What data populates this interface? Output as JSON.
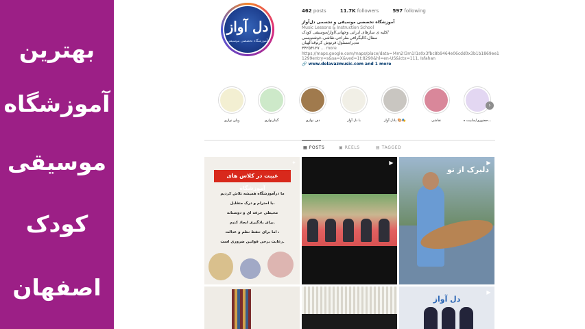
{
  "banner": {
    "lines": [
      "بهترین",
      "آموزشگاه",
      "موسیقی",
      "کودک",
      "اصفهان"
    ]
  },
  "profile": {
    "avatar_text": "دل آواز",
    "avatar_caption": "آموزشگاه تخصصی موسیقی",
    "stats": {
      "posts_value": "462",
      "posts_label": "posts",
      "followers_value": "11.7K",
      "followers_label": "followers",
      "following_value": "597",
      "following_label": "following"
    },
    "bio": {
      "name": "آموزشگاه تخصصی موسیقی و تجسمی دل‌آواز",
      "category": "Music Lessons & Instruction School",
      "line1": "کلیه ی سازهای ایرانی وجهانی/آواز/موسیقی کودک/",
      "line2": "سفال،کالیگرافی،طراحی،نقاشی،خوشنویسی",
      "line3": "مدیر/مسئول:فرنوش کرم‌قدالهیان",
      "line4": "۳۴۲۵۴۱۲۷",
      "more": "... more",
      "url": "https://maps.google.com/maps/place/data=!4m2!3m1!1s0x3fbc8b9464e06cdd0x3b1b1869ee11299entry=s&sa=X&ved=1t:8290&hl=en-US&ictx=111, Isfahan",
      "website": "www.delavazmusic.com and 1 more"
    }
  },
  "highlights": [
    {
      "label": "حضوری/سابیت ه...",
      "icon": "music-icon"
    },
    {
      "label": "نقاشی",
      "icon": "flower-icon"
    },
    {
      "label": "پادل آواز 🎨🎭",
      "icon": "chair-icon"
    },
    {
      "label": "با دل آواز",
      "icon": "music-logo-icon"
    },
    {
      "label": "دف نوازی",
      "icon": "daf-icon"
    },
    {
      "label": "گیتارنوازی",
      "icon": "guitar-icon"
    },
    {
      "label": "ویلن نوازی",
      "icon": "violin-icon"
    }
  ],
  "tabs": {
    "posts": "POSTS",
    "reels": "REELS",
    "tagged": "TAGGED"
  },
  "posts": {
    "p1_banner": "غیبت در کلاس های آموزشگاه",
    "p1_lines": [
      "ما درآموزشگاه همیشه تلاش کردیم",
      "با احترام و درک متقابل،",
      "محیطی حرفه ای و دوستانه",
      "برای یادگیری ایجاد کنیم.",
      "اما برای حفظ نظم و عدالت ،",
      "رعایت برخی قوانین ضروری است."
    ],
    "p3_title": "دلبرک از تو",
    "p6_title": "دل آواز"
  },
  "colors": {
    "banner": "#9c1f86",
    "link": "#00376b",
    "alert_red": "#d8291c"
  }
}
